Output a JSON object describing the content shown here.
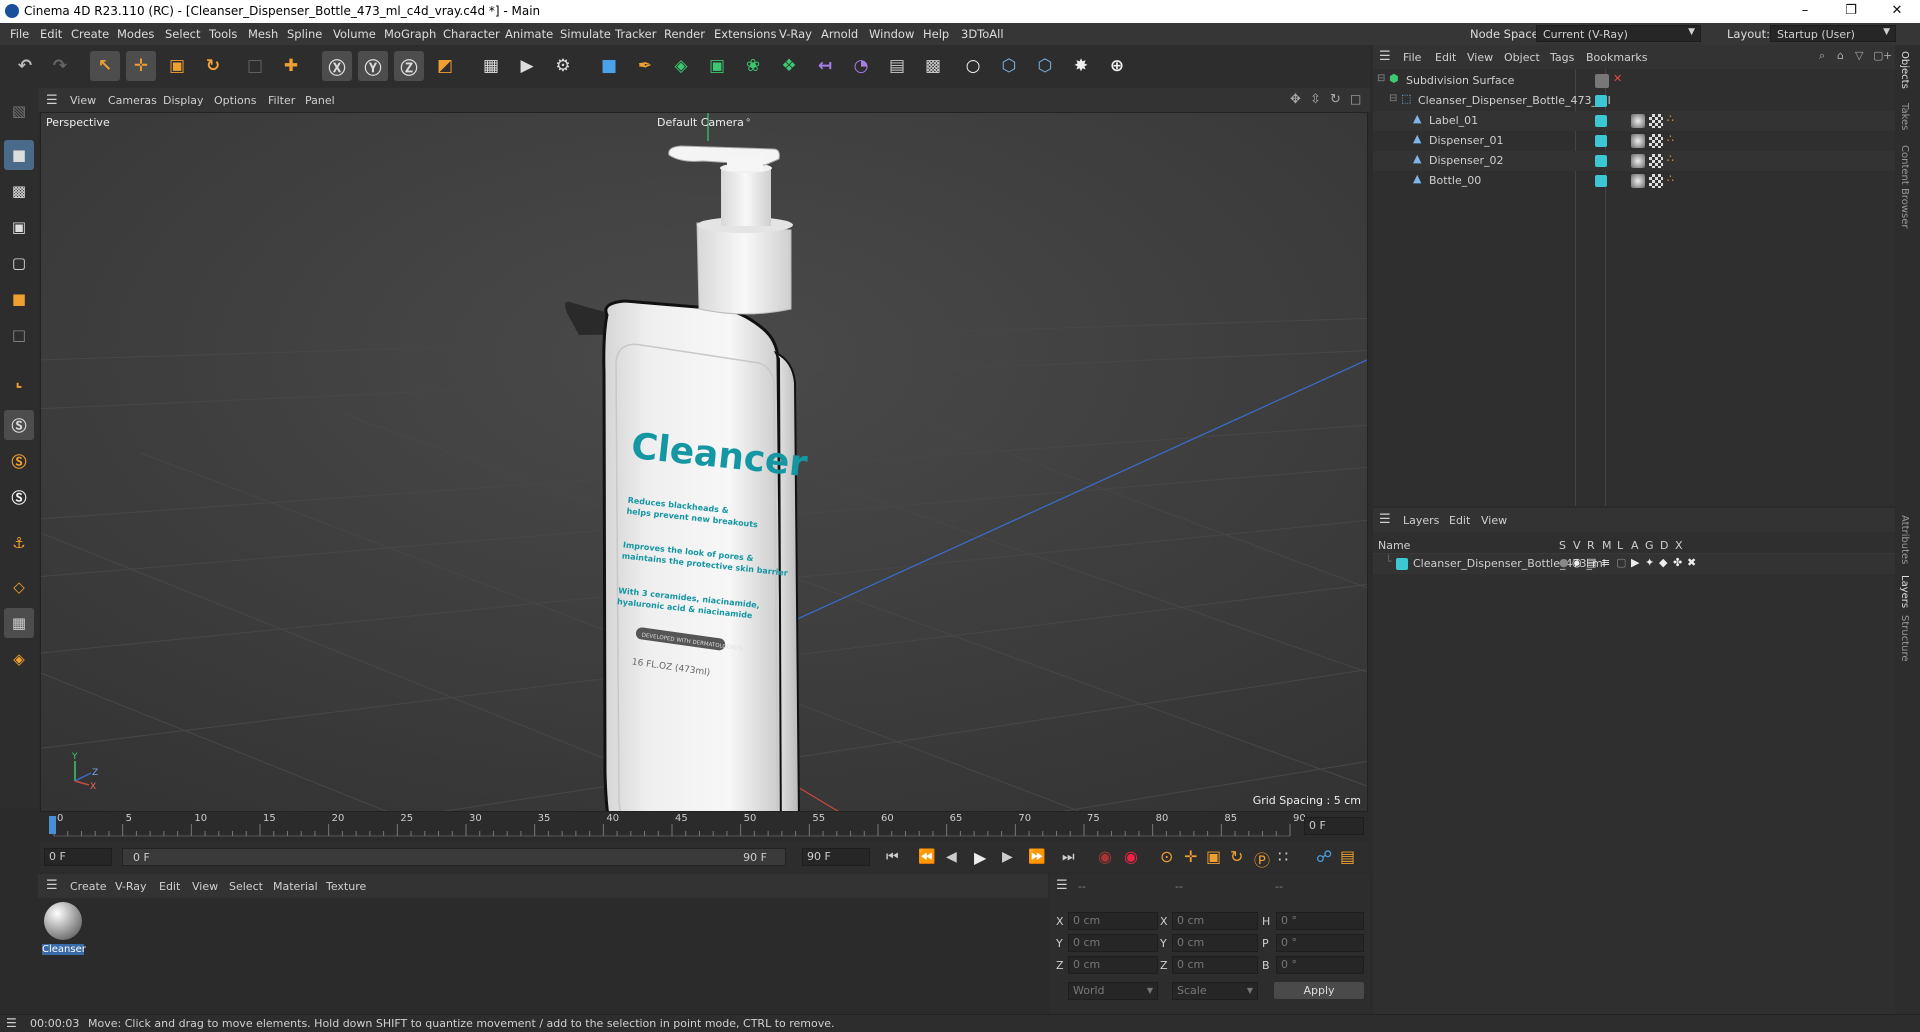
{
  "window": {
    "title": "Cinema 4D R23.110 (RC) - [Cleanser_Dispenser_Bottle_473_ml_c4d_vray.c4d *] - Main",
    "minimize_icon": "minimize-icon",
    "maximize_icon": "maximize-icon",
    "close_icon": "close-icon"
  },
  "menubar": {
    "items": [
      "File",
      "Edit",
      "Create",
      "Modes",
      "Select",
      "Tools",
      "Mesh",
      "Spline",
      "Volume",
      "MoGraph",
      "Character",
      "Animate",
      "Simulate",
      "Tracker",
      "Render",
      "Extensions",
      "V-Ray",
      "Arnold",
      "Window",
      "Help",
      "3DToAll"
    ],
    "node_space_label": "Node Space:",
    "node_space_value": "Current (V-Ray)",
    "layout_label": "Layout:",
    "layout_value": "Startup (User)"
  },
  "viewport": {
    "menu": [
      "View",
      "Cameras",
      "Display",
      "Options",
      "Filter",
      "Panel"
    ],
    "view_name": "Perspective",
    "camera": "Default Camera",
    "grid_spacing": "Grid Spacing : 5 cm",
    "axis_labels": {
      "y": "Y",
      "z": "Z",
      "x": "X"
    },
    "label_title": "Cleancer",
    "label_lines": [
      "Reduces blackheads &",
      "helps prevent new breakouts",
      "Improves the look of pores &",
      "maintains the protective skin barrier",
      "With 3 ceramides, niacinamide,",
      "hyaluronic acid & niacinamide"
    ],
    "label_badge": "DEVELOPED WITH DERMATOLOGISTS",
    "label_volume": "16 FL.OZ (473ml)"
  },
  "timeline": {
    "ticks": [
      "0",
      "5",
      "10",
      "15",
      "20",
      "25",
      "30",
      "35",
      "40",
      "45",
      "50",
      "55",
      "60",
      "65",
      "70",
      "75",
      "80",
      "85",
      "90"
    ],
    "end_frame": "0 F"
  },
  "timeline_controls": {
    "start_frame": "0 F",
    "range_start": "0 F",
    "range_end": "90 F",
    "end_frame": "90 F"
  },
  "material_manager": {
    "menu": [
      "Create",
      "V-Ray",
      "Edit",
      "View",
      "Select",
      "Material",
      "Texture"
    ],
    "materials": [
      {
        "name": "Cleanser"
      }
    ]
  },
  "coordinates": {
    "headers": [
      "--",
      "--",
      "--"
    ],
    "rows": [
      {
        "a": "X",
        "av": "0 cm",
        "b": "X",
        "bv": "0 cm",
        "c": "H",
        "cv": "0 °"
      },
      {
        "a": "Y",
        "av": "0 cm",
        "b": "Y",
        "bv": "0 cm",
        "c": "P",
        "cv": "0 °"
      },
      {
        "a": "Z",
        "av": "0 cm",
        "b": "Z",
        "bv": "0 cm",
        "c": "B",
        "cv": "0 °"
      }
    ],
    "mode": "World",
    "scale_mode": "Scale",
    "apply_label": "Apply"
  },
  "object_manager": {
    "menu": [
      "File",
      "Edit",
      "View",
      "Object",
      "Tags",
      "Bookmarks"
    ],
    "objects": [
      {
        "name": "Subdivision Surface",
        "level": 0
      },
      {
        "name": "Cleanser_Dispenser_Bottle_473_ml",
        "level": 1
      },
      {
        "name": "Label_01",
        "level": 2
      },
      {
        "name": "Dispenser_01",
        "level": 2
      },
      {
        "name": "Dispenser_02",
        "level": 2
      },
      {
        "name": "Bottle_00",
        "level": 2
      }
    ]
  },
  "layer_manager": {
    "menu": [
      "Layers",
      "Edit",
      "View"
    ],
    "name_header": "Name",
    "flags": [
      "S",
      "V",
      "R",
      "M",
      "L",
      "A",
      "G",
      "D",
      "X"
    ],
    "layers": [
      {
        "name": "Cleanser_Dispenser_Bottle_473_ml"
      }
    ]
  },
  "right_tabs": [
    "Objects",
    "Takes",
    "Content Browser",
    "Attributes",
    "Layers",
    "Structure"
  ],
  "statusbar": {
    "time": "00:00:03",
    "message": "Move: Click and drag to move elements. Hold down SHIFT to quantize movement / add to the selection in point mode, CTRL to remove."
  },
  "colors": {
    "accent": "#3cc8d2",
    "label_text": "#1596a3",
    "highlight": "#4a8fd6"
  }
}
